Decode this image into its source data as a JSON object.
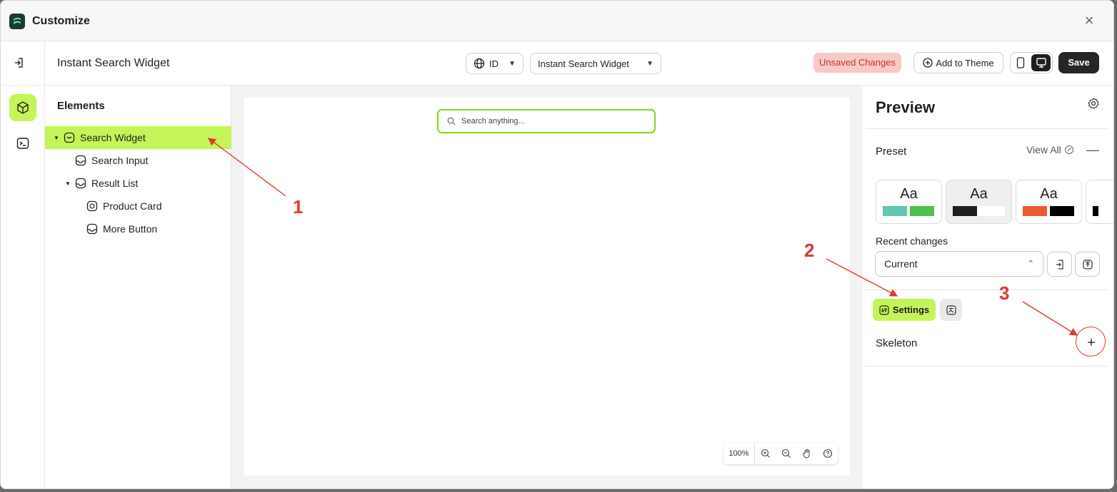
{
  "window": {
    "title": "Customize"
  },
  "toolbar": {
    "doc_title": "Instant Search Widget",
    "language": "ID",
    "widget_select": "Instant Search Widget",
    "unsaved": "Unsaved Changes",
    "add_to_theme": "Add to Theme",
    "save": "Save"
  },
  "elements": {
    "heading": "Elements",
    "tree": [
      {
        "label": "Search Widget",
        "selected": true
      },
      {
        "label": "Search Input"
      },
      {
        "label": "Result List"
      },
      {
        "label": "Product Card"
      },
      {
        "label": "More Button"
      }
    ]
  },
  "canvas": {
    "search_placeholder": "Search anything...",
    "zoom": "100%"
  },
  "preview": {
    "title": "Preview",
    "preset_label": "Preset",
    "view_all": "View All",
    "presets": [
      {
        "label": "Aa",
        "colors": [
          "#5fc7b2",
          "#4fbf4f"
        ]
      },
      {
        "label": "Aa",
        "colors": [
          "#1f1f1f",
          "#ffffff"
        ]
      },
      {
        "label": "Aa",
        "colors": [
          "#ea5a35",
          "#000000"
        ]
      }
    ],
    "recent_label": "Recent changes",
    "recent_value": "Current",
    "settings_tab": "Settings",
    "skeleton_label": "Skeleton"
  },
  "annotations": [
    "1",
    "2",
    "3"
  ],
  "colors": {
    "accent": "#c5f45a",
    "annotation": "#e03a2c",
    "unsaved_bg": "#f8c9c6",
    "unsaved_text": "#c7342b"
  }
}
